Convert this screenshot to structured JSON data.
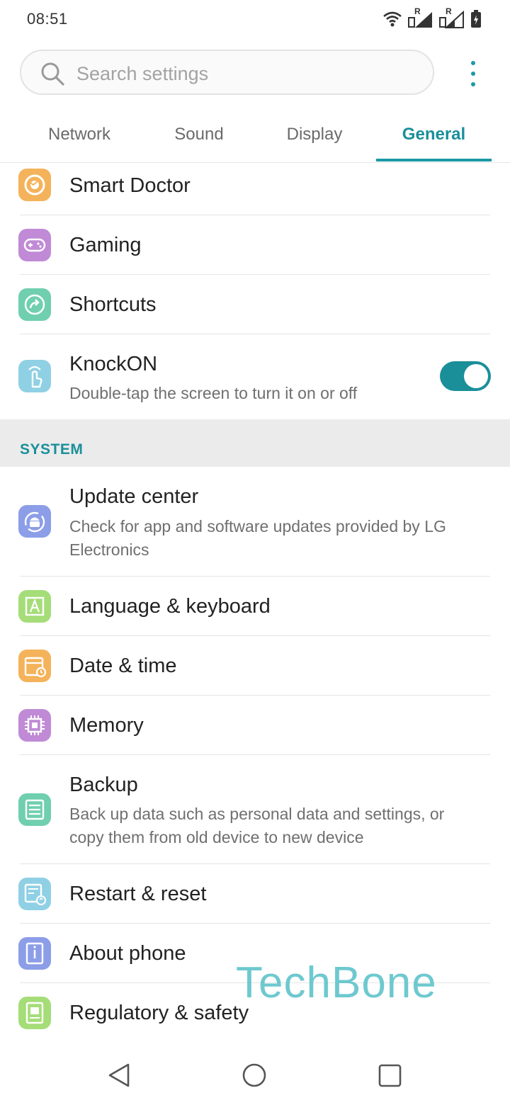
{
  "status_bar": {
    "time": "08:51",
    "icons": [
      "wifi-icon",
      "signal-roaming-icon",
      "signal-roaming-icon",
      "battery-icon"
    ],
    "roaming_label": "R"
  },
  "search": {
    "placeholder": "Search settings",
    "icon": "search-icon"
  },
  "tabs": [
    {
      "label": "Network",
      "active": false
    },
    {
      "label": "Sound",
      "active": false
    },
    {
      "label": "Display",
      "active": false
    },
    {
      "label": "General",
      "active": true
    }
  ],
  "general_items": [
    {
      "title": "Smart Doctor",
      "icon": "smart-doctor-icon",
      "icon_color": "#f4b35a"
    },
    {
      "title": "Gaming",
      "icon": "gamepad-icon",
      "icon_color": "#c08ad6"
    },
    {
      "title": "Shortcuts",
      "icon": "shortcut-arrow-icon",
      "icon_color": "#6fcfae"
    },
    {
      "title": "KnockON",
      "subtitle": "Double-tap the screen to turn it on or off",
      "icon": "tap-hand-icon",
      "icon_color": "#8fd0e4",
      "toggle": true
    }
  ],
  "system_section": {
    "header": "SYSTEM",
    "items": [
      {
        "title": "Update center",
        "subtitle": "Check for app and software updates provided by LG Electronics",
        "icon": "update-android-icon",
        "icon_color": "#8c9ee8"
      },
      {
        "title": "Language & keyboard",
        "icon": "language-a-icon",
        "icon_color": "#a5dd78"
      },
      {
        "title": "Date & time",
        "icon": "calendar-clock-icon",
        "icon_color": "#f4b35a"
      },
      {
        "title": "Memory",
        "icon": "memory-chip-icon",
        "icon_color": "#c08ad6"
      },
      {
        "title": "Backup",
        "subtitle": "Back up data such as personal data and settings, or copy them from old device to new device",
        "icon": "backup-list-icon",
        "icon_color": "#6fcfae"
      },
      {
        "title": "Restart & reset",
        "icon": "reset-icon",
        "icon_color": "#8fd0e4"
      },
      {
        "title": "About phone",
        "icon": "info-phone-icon",
        "icon_color": "#8c9ee8"
      },
      {
        "title": "Regulatory & safety",
        "icon": "regulatory-icon",
        "icon_color": "#a5dd78"
      }
    ]
  },
  "watermark": "TechBone",
  "nav_bar": {
    "buttons": [
      "back-icon",
      "home-icon",
      "recents-icon"
    ]
  },
  "colors": {
    "accent": "#1a8f9a",
    "section_bg": "#ebebeb",
    "divider": "#e4e4e4"
  }
}
